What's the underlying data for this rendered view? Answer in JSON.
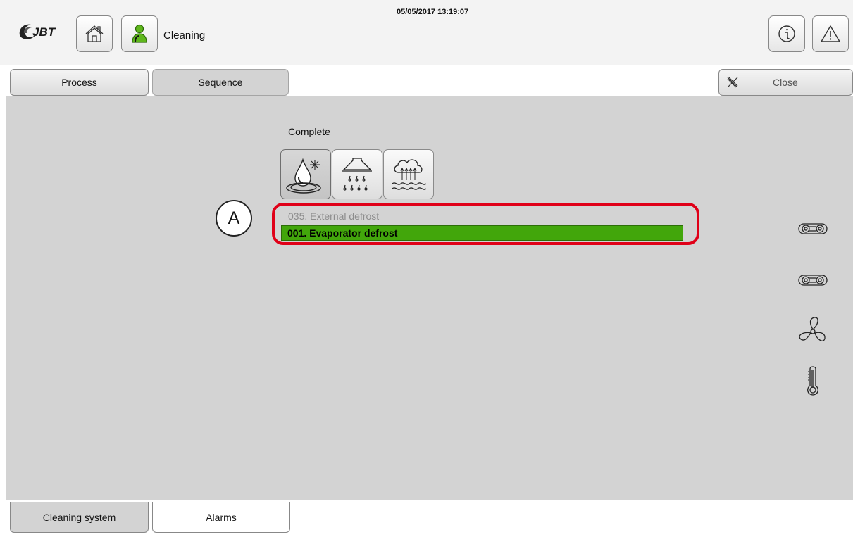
{
  "header": {
    "logo_text": "JBT",
    "screen_title": "Cleaning",
    "datetime": "05/05/2017 13:19:07",
    "icons": [
      "home-icon",
      "user-icon",
      "info-icon",
      "warning-icon"
    ]
  },
  "toolbar": {
    "tabs": [
      {
        "label": "Process",
        "active": false
      },
      {
        "label": "Sequence",
        "active": true
      }
    ],
    "close_label": "Close"
  },
  "main": {
    "status_label": "Complete",
    "step_icons": [
      "defrost-drop-icon",
      "spray-nozzle-icon",
      "steam-cloud-icon"
    ],
    "callout_label": "A",
    "sequence": {
      "previous": "035. External defrost",
      "current": "001. Evaporator defrost"
    },
    "side_icons": [
      "chain-icon",
      "chain-icon",
      "fan-icon",
      "thermometer-icon"
    ],
    "colors": {
      "active_step": "#42a60b",
      "callout_border": "#e00018",
      "panel_bg": "#d3d3d3"
    }
  },
  "bottom_tabs": [
    {
      "label": "Cleaning system",
      "active": true
    },
    {
      "label": "Alarms",
      "active": false
    }
  ]
}
